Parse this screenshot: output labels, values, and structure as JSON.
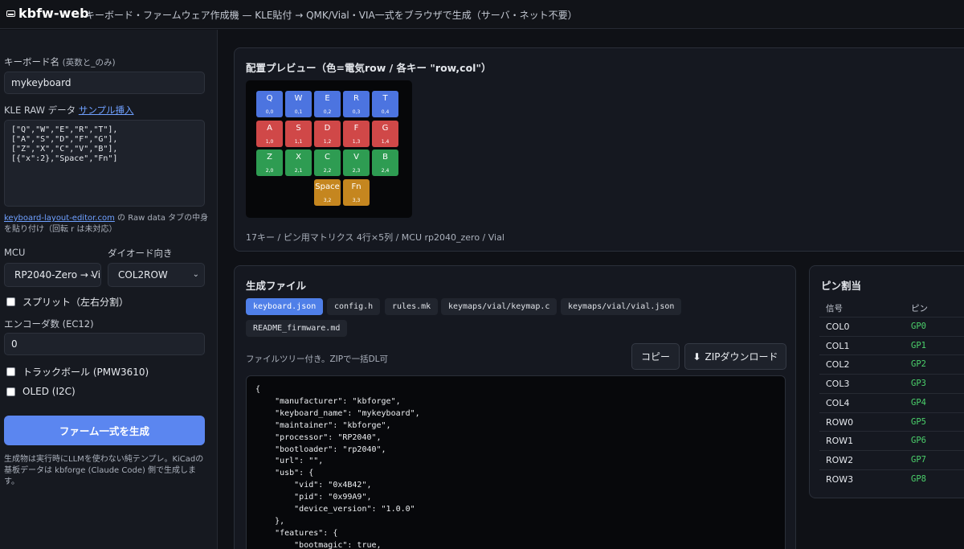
{
  "header": {
    "brand": "kbfw-web",
    "tagline": "キーボード・ファームウェア作成機 — KLE貼付 → QMK/Vial・VIA一式をブラウザで生成（サーバ・ネット不要）"
  },
  "sidebar": {
    "name_label": "キーボード名",
    "name_hint": "(英数と_のみ)",
    "name_value": "mykeyboard",
    "kle_label": "KLE RAW データ",
    "kle_sample_link": "サンプル挿入",
    "kle_raw": "[\"Q\",\"W\",\"E\",\"R\",\"T\"],\n[\"A\",\"S\",\"D\",\"F\",\"G\"],\n[\"Z\",\"X\",\"C\",\"V\",\"B\"],\n[{\"x\":2},\"Space\",\"Fn\"]",
    "kle_hint_link": "keyboard-layout-editor.com",
    "kle_hint_line1": " の Raw data タブの中身",
    "kle_hint_line2": "を貼り付け（回転 r は未対応）",
    "mcu_label": "MCU",
    "mcu_value": "RP2040-Zero → Vi",
    "diode_label": "ダイオード向き",
    "diode_value": "COL2ROW",
    "split_label": "スプリット（左右分割）",
    "encoder_label": "エンコーダ数 (EC12)",
    "encoder_value": "0",
    "trackball_label": "トラックボール (PMW3610)",
    "oled_label": "OLED (I2C)",
    "generate_button": "ファーム一式を生成",
    "footnote": "生成物は実行時にLLMを使わない純テンプレ。KiCadの基板データは kbforge (Claude Code) 側で生成します。"
  },
  "preview": {
    "title": "配置プレビュー（色=電気row / 各キー \"row,col\"）",
    "summary": "17キー / ピン用マトリクス 4行×5列 / MCU rp2040_zero / Vial",
    "row_colors": [
      "#4c74e0",
      "#d04848",
      "#2e9c52",
      "#c5861f"
    ],
    "keys": [
      {
        "label": "Q",
        "coord": "0,0"
      },
      {
        "label": "W",
        "coord": "0,1"
      },
      {
        "label": "E",
        "coord": "0,2"
      },
      {
        "label": "R",
        "coord": "0,3"
      },
      {
        "label": "T",
        "coord": "0,4"
      },
      {
        "label": "A",
        "coord": "1,0"
      },
      {
        "label": "S",
        "coord": "1,1"
      },
      {
        "label": "D",
        "coord": "1,2"
      },
      {
        "label": "F",
        "coord": "1,3"
      },
      {
        "label": "G",
        "coord": "1,4"
      },
      {
        "label": "Z",
        "coord": "2,0"
      },
      {
        "label": "X",
        "coord": "2,1"
      },
      {
        "label": "C",
        "coord": "2,2"
      },
      {
        "label": "V",
        "coord": "2,3"
      },
      {
        "label": "B",
        "coord": "2,4"
      },
      {
        "label": "Space",
        "coord": "3,2"
      },
      {
        "label": "Fn",
        "coord": "3,3"
      }
    ]
  },
  "files": {
    "title": "生成ファイル",
    "tabs": [
      "keyboard.json",
      "config.h",
      "rules.mk",
      "keymaps/vial/keymap.c",
      "keymaps/vial/vial.json",
      "README_firmware.md"
    ],
    "tree_note": "ファイルツリー付き。ZIPで一括DL可",
    "copy_button": "コピー",
    "zip_button": "ZIPダウンロード",
    "code": "{\n    \"manufacturer\": \"kbforge\",\n    \"keyboard_name\": \"mykeyboard\",\n    \"maintainer\": \"kbforge\",\n    \"processor\": \"RP2040\",\n    \"bootloader\": \"rp2040\",\n    \"url\": \"\",\n    \"usb\": {\n        \"vid\": \"0x4B42\",\n        \"pid\": \"0x99A9\",\n        \"device_version\": \"1.0.0\"\n    },\n    \"features\": {\n        \"bootmagic\": true,"
  },
  "pins": {
    "title": "ピン割当",
    "headers": [
      "信号",
      "ピン"
    ],
    "rows": [
      {
        "signal": "COL0",
        "pin": "GP0"
      },
      {
        "signal": "COL1",
        "pin": "GP1"
      },
      {
        "signal": "COL2",
        "pin": "GP2"
      },
      {
        "signal": "COL3",
        "pin": "GP3"
      },
      {
        "signal": "COL4",
        "pin": "GP4"
      },
      {
        "signal": "ROW0",
        "pin": "GP5"
      },
      {
        "signal": "ROW1",
        "pin": "GP6"
      },
      {
        "signal": "ROW2",
        "pin": "GP7"
      },
      {
        "signal": "ROW3",
        "pin": "GP8"
      }
    ]
  }
}
